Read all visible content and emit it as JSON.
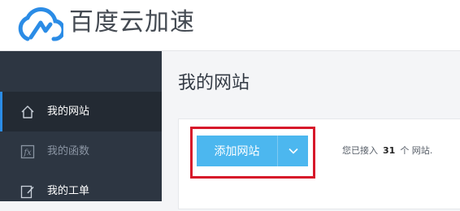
{
  "brand": {
    "name": "百度云加速",
    "color": "#2b8ce6"
  },
  "sidebar": {
    "items": [
      {
        "label": "我的网站",
        "icon": "home-icon",
        "state": "active"
      },
      {
        "label": "我的函数",
        "icon": "function-icon",
        "state": "dim"
      },
      {
        "label": "我的工单",
        "icon": "edit-icon",
        "state": "normal"
      }
    ]
  },
  "main": {
    "title": "我的网站",
    "add_button_label": "添加网站",
    "dropdown_icon": "chevron-down-icon",
    "site_count": {
      "prefix": "您已接入",
      "count": "31",
      "suffix": "个 网站."
    }
  },
  "colors": {
    "accent_button": "#4cb7ef",
    "sidebar_bg": "#2d3642",
    "highlight_box": "#d7182a"
  }
}
